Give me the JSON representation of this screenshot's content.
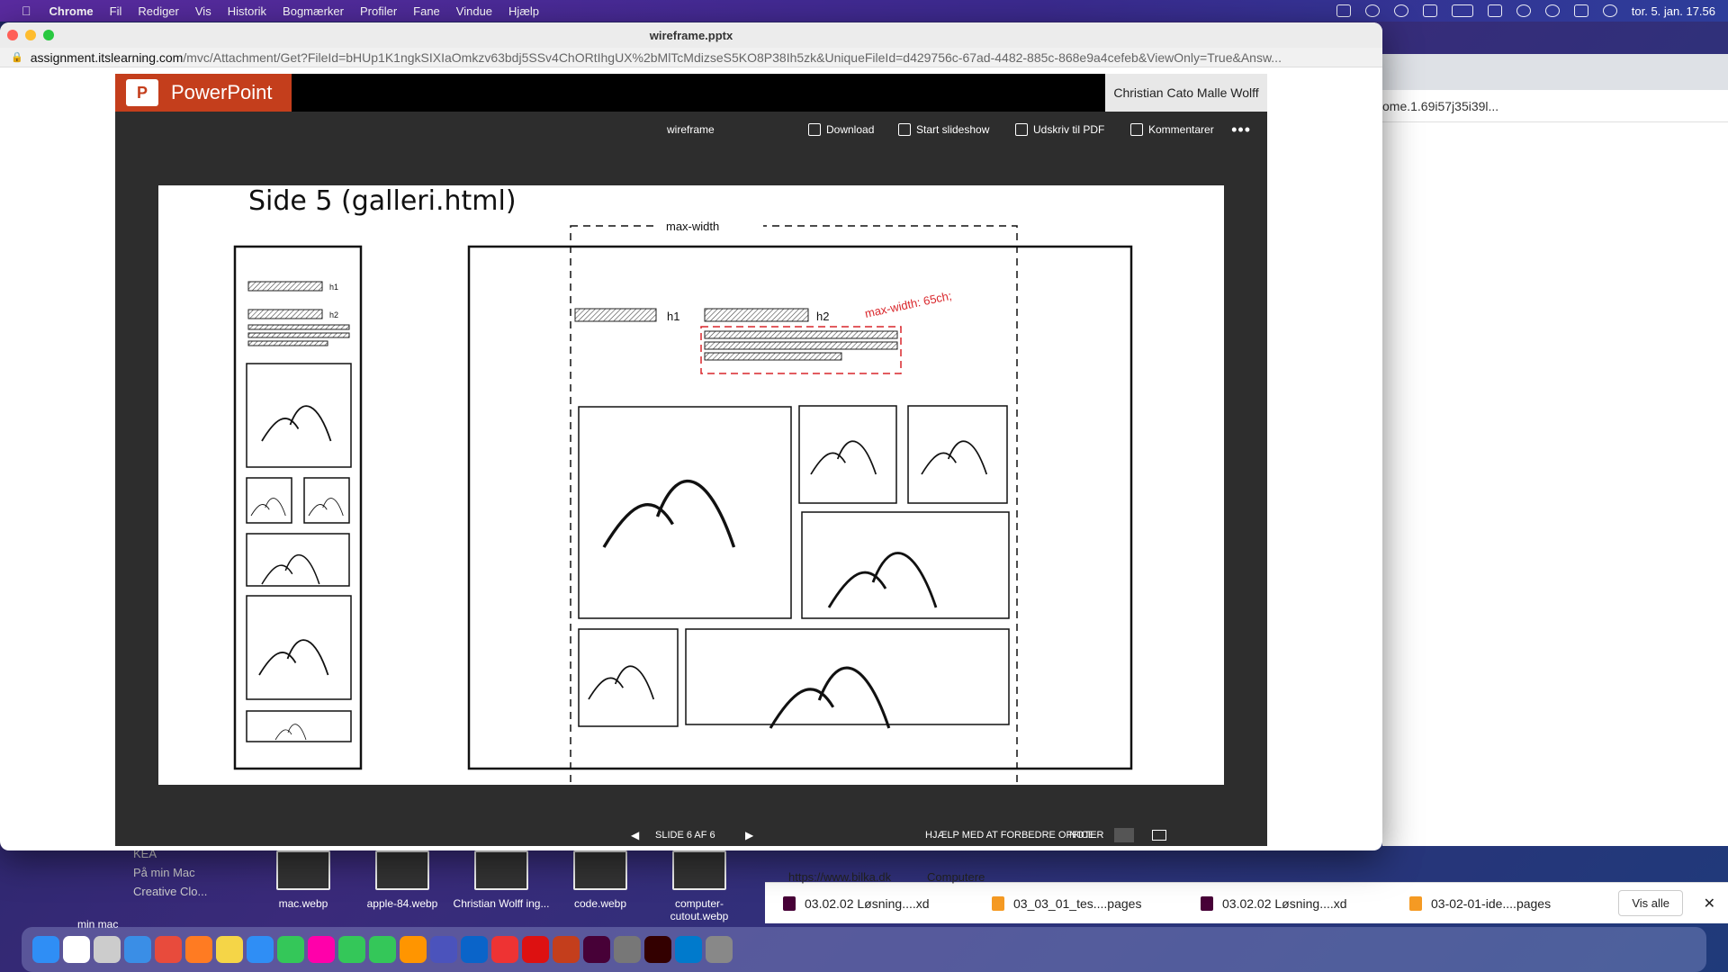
{
  "menubar": {
    "app": "Chrome",
    "items": [
      "Fil",
      "Rediger",
      "Vis",
      "Historik",
      "Bogmærker",
      "Profiler",
      "Fane",
      "Vindue",
      "Hjælp"
    ],
    "clock": "tor. 5. jan.  17.56"
  },
  "window": {
    "title": "wireframe.pptx",
    "url_host": "assignment.itslearning.com",
    "url_rest": "/mvc/Attachment/Get?FileId=bHUp1K1ngkSIXIaOmkzv63bdj5SSv4ChORtIhgUX%2bMlTcMdizseS5KO8P38Ih5zk&UniqueFileId=d429756c-67ad-4482-885c-868e9a4cefeb&ViewOnly=True&Answ..."
  },
  "ppt": {
    "brand": "PowerPoint",
    "user": "Christian Cato Malle Wolff",
    "doc_name": "wireframe",
    "toolbar": {
      "download": "Download",
      "slideshow": "Start slideshow",
      "print": "Udskriv til PDF",
      "comments": "Kommentarer",
      "more": "•••"
    },
    "status": {
      "counter": "SLIDE 6 AF 6",
      "help": "HJÆLP MED AT FORBEDRE OFFICE",
      "notes": "NOTER"
    }
  },
  "slide": {
    "title": "Side 5 (galleri.html)",
    "max_width_label": "max-width",
    "h1": "h1",
    "h2": "h2",
    "mobile_h1": "h1",
    "mobile_h2": "h2",
    "red_annotation": "max-width: 65ch;",
    "red_color": "#d9262b"
  },
  "right_window": {
    "address": "ome.1.69i57j35i39l..."
  },
  "finder": {
    "items": [
      "KEA",
      "På min Mac",
      "Creative Clo..."
    ],
    "fragment": "min mac"
  },
  "desktop_files": [
    {
      "label": "mac.webp"
    },
    {
      "label": "apple-84.webp"
    },
    {
      "label": "Christian Wolff ing..."
    },
    {
      "label": "code.webp"
    },
    {
      "label": "computer-cutout.webp"
    }
  ],
  "downloads": {
    "items": [
      "03.02.02 Løsning....xd",
      "03_03_01_tes....pages",
      "03.02.02 Løsning....xd",
      "03-02-01-ide....pages"
    ],
    "show_all": "Vis alle",
    "behind_url": "https://www.bilka.dk",
    "behind_crumb": "Computere"
  }
}
